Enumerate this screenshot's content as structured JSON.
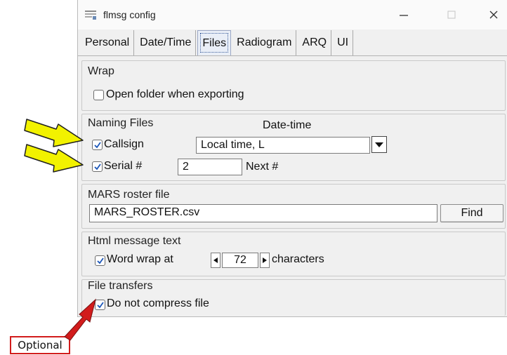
{
  "window": {
    "title": "flmsg config"
  },
  "tabs": [
    {
      "label": "Personal"
    },
    {
      "label": "Date/Time"
    },
    {
      "label": "Files",
      "active": true
    },
    {
      "label": "Radiogram"
    },
    {
      "label": "ARQ"
    },
    {
      "label": "UI"
    }
  ],
  "wrap": {
    "group_label": "Wrap",
    "open_folder": {
      "label": "Open folder when exporting",
      "checked": false
    }
  },
  "naming": {
    "group_label": "Naming Files",
    "datetime_label": "Date-time",
    "callsign": {
      "label": "Callsign",
      "checked": true
    },
    "datetime_value": "Local time,  L",
    "serial": {
      "label": "Serial #",
      "checked": true
    },
    "serial_value": "2",
    "next_label": "Next #"
  },
  "mars": {
    "group_label": "MARS roster file",
    "file_value": "MARS_ROSTER.csv",
    "find_label": "Find"
  },
  "html_msg": {
    "group_label": "Html message text",
    "wordwrap": {
      "label": "Word wrap at",
      "checked": true
    },
    "wrap_value": "72",
    "characters_label": "characters"
  },
  "transfers": {
    "group_label": "File transfers",
    "no_compress": {
      "label": "Do not compress file",
      "checked": true
    }
  },
  "annotation": {
    "label": "Optional"
  },
  "colors": {
    "annotation_red": "#d21c1c",
    "arrow_yellow": "#f2f200",
    "accent_blue": "#1a55b8"
  }
}
